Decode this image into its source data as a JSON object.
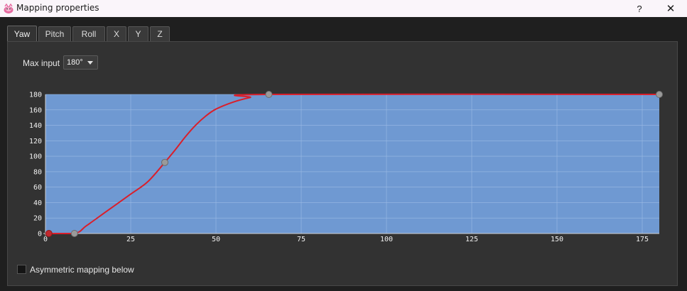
{
  "window": {
    "title": "Mapping properties",
    "help_label": "?",
    "close_label": "✕"
  },
  "tabs": [
    {
      "label": "Yaw",
      "active": true
    },
    {
      "label": "Pitch",
      "active": false
    },
    {
      "label": "Roll",
      "active": false
    },
    {
      "label": "X",
      "active": false
    },
    {
      "label": "Y",
      "active": false
    },
    {
      "label": "Z",
      "active": false
    }
  ],
  "max_input": {
    "label": "Max input",
    "value": "180°"
  },
  "chart_data": {
    "type": "line",
    "title": "",
    "xlabel": "",
    "ylabel": "",
    "xlim": [
      0,
      180
    ],
    "ylim": [
      0,
      180
    ],
    "x_ticks": [
      0,
      25,
      50,
      75,
      100,
      125,
      150,
      175
    ],
    "y_ticks": [
      0,
      20,
      40,
      60,
      80,
      100,
      120,
      140,
      160,
      180
    ],
    "grid": true,
    "colors": {
      "plot_bg": "#6f99d2",
      "curve": "#d91f2b",
      "grid": "#9cbbe4",
      "point": "#9a9a9a",
      "point_selected": "#c2272d"
    },
    "control_points": [
      {
        "x": 1,
        "y": 0,
        "selected": true
      },
      {
        "x": 8.5,
        "y": 0
      },
      {
        "x": 35,
        "y": 92
      },
      {
        "x": 65.5,
        "y": 180
      },
      {
        "x": 180,
        "y": 180
      }
    ],
    "curve": [
      {
        "x": 0,
        "y": 0
      },
      {
        "x": 8.5,
        "y": 0
      },
      {
        "x": 12,
        "y": 10
      },
      {
        "x": 18,
        "y": 29
      },
      {
        "x": 25,
        "y": 51
      },
      {
        "x": 30,
        "y": 67
      },
      {
        "x": 35,
        "y": 92
      },
      {
        "x": 38,
        "y": 108
      },
      {
        "x": 41,
        "y": 125
      },
      {
        "x": 44,
        "y": 140
      },
      {
        "x": 47,
        "y": 152
      },
      {
        "x": 50,
        "y": 161
      },
      {
        "x": 55,
        "y": 170
      },
      {
        "x": 60,
        "y": 176
      },
      {
        "x": 65.5,
        "y": 180
      },
      {
        "x": 180,
        "y": 180
      }
    ]
  },
  "asymmetric": {
    "label": "Asymmetric mapping below",
    "checked": false
  }
}
